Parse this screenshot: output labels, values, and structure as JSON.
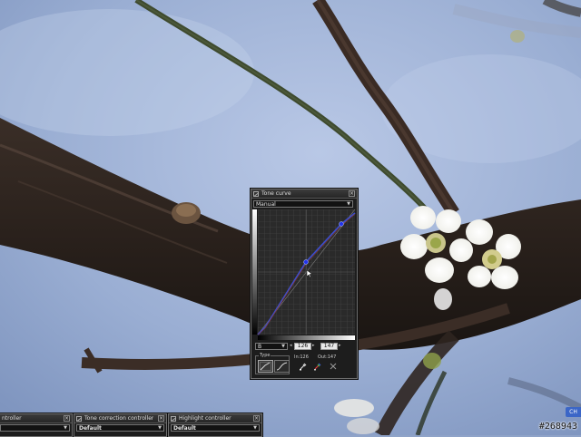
{
  "tone_curve": {
    "title": "Tone curve",
    "mode": "Manual",
    "channel": "B",
    "input_value": "126",
    "output_value": "147",
    "in_readout": "In:126",
    "out_readout": "Out:147",
    "type_label": "Type",
    "curve_color": "#3a4fd0"
  },
  "bottom_panels": [
    {
      "title": "ntroller",
      "preset": ""
    },
    {
      "title": "Tone correction controller",
      "preset": "Default"
    },
    {
      "title": "Highlight controller",
      "preset": "Default"
    }
  ],
  "corner_badge": "CH",
  "watermark": "#268943"
}
